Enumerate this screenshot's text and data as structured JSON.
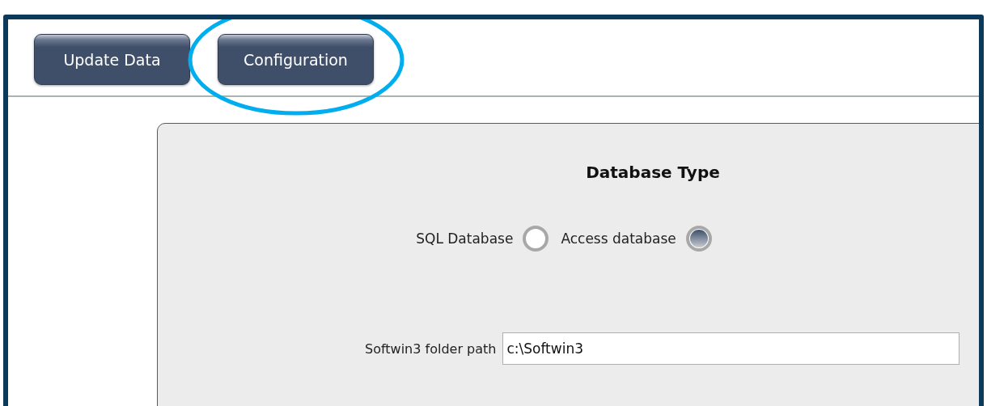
{
  "toolbar": {
    "buttons": [
      {
        "label": "Update Data",
        "highlighted": false
      },
      {
        "label": "Configuration",
        "highlighted": true
      }
    ]
  },
  "panel": {
    "title": "Database Type",
    "database_options": [
      {
        "label": "SQL Database",
        "selected": false
      },
      {
        "label": "Access database",
        "selected": true
      }
    ],
    "folder_path": {
      "label": "Softwin3 folder path",
      "value": "c:\\Softwin3"
    }
  }
}
